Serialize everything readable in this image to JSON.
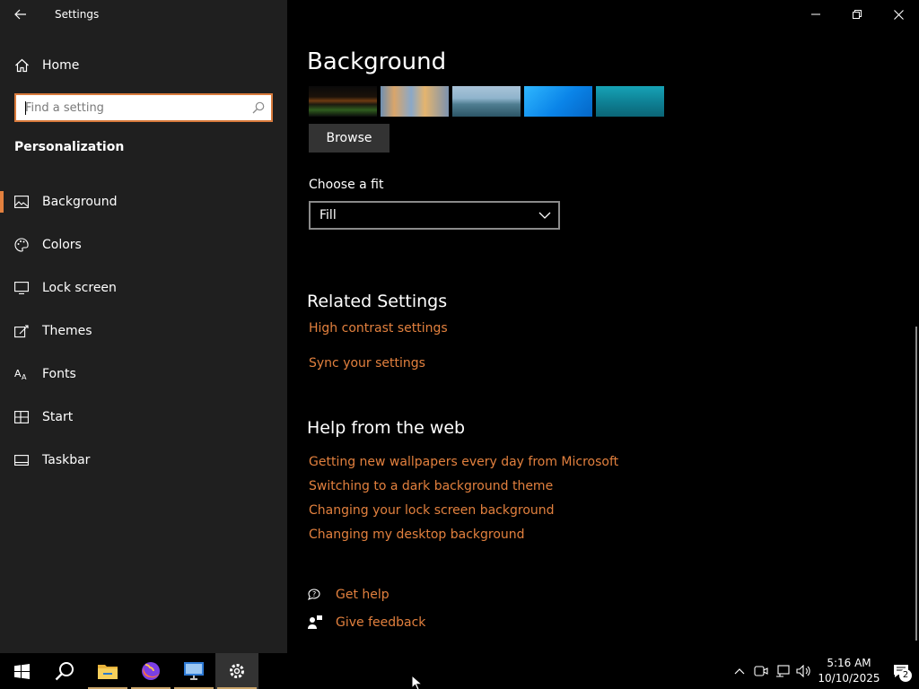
{
  "app": {
    "title": "Settings"
  },
  "sidebar": {
    "home_label": "Home",
    "search_placeholder": "Find a setting",
    "section_title": "Personalization",
    "items": [
      {
        "label": "Background",
        "icon": "picture-icon",
        "active": true
      },
      {
        "label": "Colors",
        "icon": "palette-icon",
        "active": false
      },
      {
        "label": "Lock screen",
        "icon": "lock-screen-icon",
        "active": false
      },
      {
        "label": "Themes",
        "icon": "themes-icon",
        "active": false
      },
      {
        "label": "Fonts",
        "icon": "fonts-icon",
        "active": false
      },
      {
        "label": "Start",
        "icon": "start-icon",
        "active": false
      },
      {
        "label": "Taskbar",
        "icon": "taskbar-icon",
        "active": false
      }
    ]
  },
  "main": {
    "title": "Background",
    "browse_label": "Browse",
    "fit_label": "Choose a fit",
    "fit_value": "Fill",
    "related": {
      "title": "Related Settings",
      "links": [
        "High contrast settings",
        "Sync your settings"
      ]
    },
    "help": {
      "title": "Help from the web",
      "links": [
        "Getting new wallpapers every day from Microsoft",
        "Switching to a dark background theme",
        "Changing your lock screen background",
        "Changing my desktop background"
      ]
    },
    "get_help": "Get help",
    "give_feedback": "Give feedback"
  },
  "taskbar": {
    "time": "5:16 AM",
    "date": "10/10/2025",
    "notification_count": "2"
  },
  "colors": {
    "accent": "#e2803e",
    "sidebar_bg": "#1f1f1f",
    "main_bg": "#000000"
  }
}
